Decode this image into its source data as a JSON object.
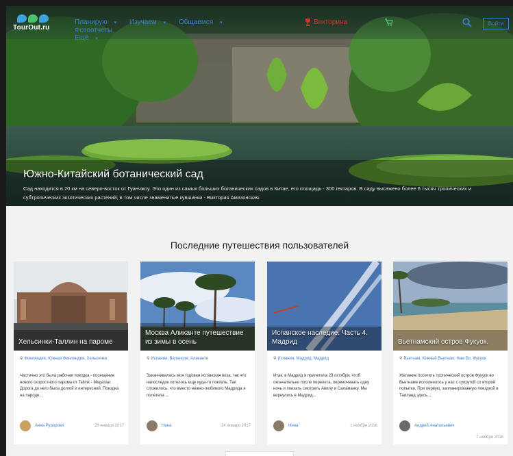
{
  "header": {
    "logo_text": "TourOut.ru",
    "nav": [
      {
        "label": "Планирую"
      },
      {
        "label": "Изучаем"
      },
      {
        "label": "Общаемся"
      },
      {
        "label": "Фотоотчеты"
      },
      {
        "label": "Ещё"
      }
    ],
    "quiz_label": "Викторина",
    "login_label": "Войти"
  },
  "hero": {
    "title": "Южно-Китайский ботанический сад",
    "description": "Сад находится в 20 км на северо-восток от Гуанчжоу. Это один из самых больших ботанических садов в Китае, его площадь - 300 гектаров. В саду высажено более 6 тысяч тропических и субтропических экзотических растений, в том числе знаменитые кувшинки - Виктория Амазонская."
  },
  "section": {
    "title": "Последние путешествия пользователей"
  },
  "cards": [
    {
      "title": "Хельсинки-Таллин на пароме",
      "location": "Финляндия, Южная Финляндия, Хельсинки",
      "text": "Частично это была рабочая поездка - посещение нового скоростного парома от Tallink - Megastar. Дорога до него была долгой и интересной. Поездка на пароде...",
      "author": "Анна Руророел",
      "date": "28 января 2017"
    },
    {
      "title": "Москва Аликанте путешествие из зимы в осень",
      "location": "Испания, Валенсия, Аликанте",
      "text": "Заканчивалась моя годовая испанская виза, так что напоследок хотелось еще куда-то поехать. Так сложилось, что вместо нежно-любимого Мадрида я полетела ...",
      "author": "Нина",
      "date": "24 января 2017"
    },
    {
      "title": "Испанское наследие. Часть 4. Мадрид",
      "location": "Испания, Мадрид, Мадрид",
      "text": "Итак, в Мадрид я прилетела 23 октября, чтоб окончательно после перелета, переночевать одну ночь и поехать смотреть Авилу и Саламанку. Мы вернулись в Мадрид...",
      "author": "Нина",
      "date": "1 ноября 2016"
    },
    {
      "title": "Вьетнамский остров Фукуок.",
      "location": "Вьетнам, Южный Вьетнам, Нам Бо, Фукуок",
      "text": "Желание посетить тропический остров Фукуок во Вьетнаме исполнилось у нас с супругой со второй попытки. При первую, запланированную поездкой в Таиланд здесь...",
      "author": "Андрей Анатольевич",
      "date": "7 ноября 2016"
    }
  ]
}
